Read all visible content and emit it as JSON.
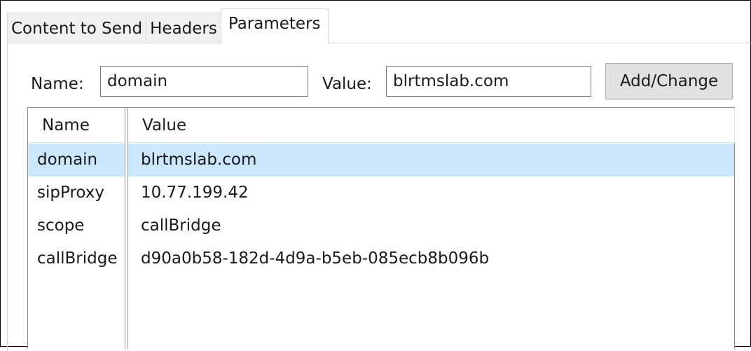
{
  "tabs": [
    {
      "label": "Content to Send"
    },
    {
      "label": "Headers"
    },
    {
      "label": "Parameters"
    }
  ],
  "form": {
    "name_label": "Name:",
    "name_value": "domain",
    "value_label": "Value:",
    "value_value": "blrtmslab.com",
    "add_change_label": "Add/Change"
  },
  "table": {
    "columns": [
      "Name",
      "Value"
    ],
    "rows": [
      {
        "name": "domain",
        "value": "blrtmslab.com"
      },
      {
        "name": "sipProxy",
        "value": "10.77.199.42"
      },
      {
        "name": "scope",
        "value": "callBridge"
      },
      {
        "name": "callBridge",
        "value": "d90a0b58-182d-4d9a-b5eb-085ecb8b096b"
      }
    ],
    "selected_row": 0
  },
  "colors": {
    "selection": "#cce8ff",
    "button_bg": "#e1e1e1",
    "tab_bg": "#f0f0f0"
  }
}
